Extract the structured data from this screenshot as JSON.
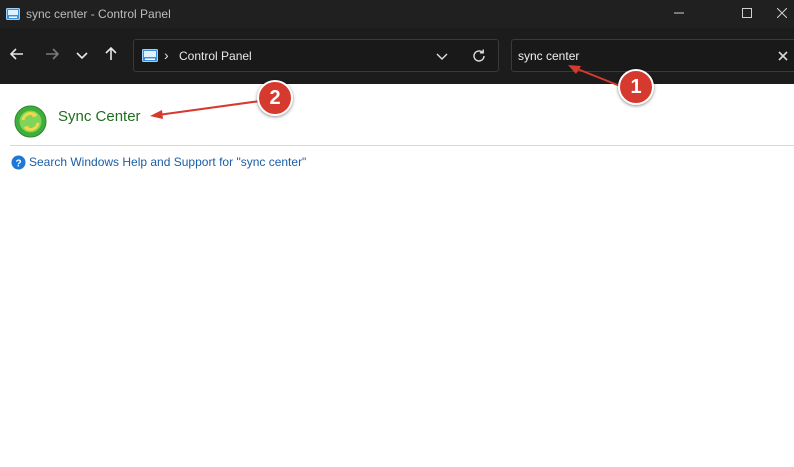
{
  "window": {
    "title": "sync center - Control Panel",
    "icon": "control-panel-icon",
    "buttons": [
      "minimize-icon",
      "maximize-icon",
      "close-icon"
    ]
  },
  "toolbar": {
    "nav": [
      "back-arrow-icon",
      "forward-arrow-icon",
      "recent-locations-chevron-icon",
      "up-arrow-icon"
    ],
    "address": {
      "separator": "›",
      "breadcrumb": "Control Panel",
      "icons": [
        "control-panel-icon",
        "dropdown-chevron-icon",
        "refresh-icon"
      ]
    },
    "search": {
      "value": "sync center",
      "clear_icon": "clear-x-icon"
    }
  },
  "results": {
    "items": [
      {
        "title": "Sync Center",
        "icon": "sync-center-icon"
      }
    ],
    "help_link": "Search Windows Help and Support for \"sync center\"",
    "help_icon": "help-question-icon"
  },
  "annotations": [
    {
      "label": "1"
    },
    {
      "label": "2"
    }
  ],
  "colors": {
    "titlebar_bg": "#202020",
    "toolbar_bg": "#1c1c1c",
    "result_title": "#1e6e1e",
    "link": "#1a5ea8",
    "badge": "#d63a2f"
  }
}
